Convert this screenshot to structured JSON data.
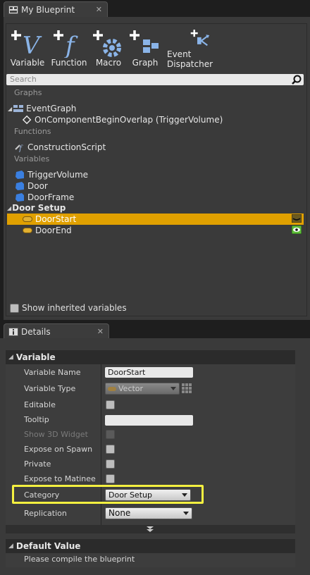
{
  "blueprint_tab": {
    "title": "My Blueprint",
    "close": "✕"
  },
  "toolbar": [
    {
      "label": "Variable",
      "icon": "add-variable-icon"
    },
    {
      "label": "Function",
      "icon": "add-function-icon"
    },
    {
      "label": "Macro",
      "icon": "add-macro-icon"
    },
    {
      "label": "Graph",
      "icon": "add-graph-icon"
    },
    {
      "label": "Event Dispatcher",
      "icon": "add-event-dispatcher-icon"
    }
  ],
  "search": {
    "placeholder": "Search"
  },
  "sections": {
    "graphs": "Graphs",
    "functions": "Functions",
    "variables": "Variables"
  },
  "graphs": {
    "event_graph": "EventGraph",
    "event": "OnComponentBeginOverlap (TriggerVolume)"
  },
  "functions": {
    "construction_script": "ConstructionScript"
  },
  "variables": [
    "TriggerVolume",
    "Door",
    "DoorFrame"
  ],
  "door_setup": {
    "category": "Door Setup",
    "items": [
      {
        "label": "DoorStart",
        "selected": true
      },
      {
        "label": "DoorEnd",
        "selected": false
      }
    ]
  },
  "show_inherited": "Show inherited variables",
  "details_tab": {
    "title": "Details",
    "close": "✕"
  },
  "details": {
    "section_variable": "Variable",
    "labels": {
      "name": "Variable Name",
      "type": "Variable Type",
      "editable": "Editable",
      "tooltip": "Tooltip",
      "show3d": "Show 3D Widget",
      "expose_spawn": "Expose on Spawn",
      "private": "Private",
      "expose_matinee": "Expose to Matinee",
      "category": "Category",
      "replication": "Replication"
    },
    "values": {
      "name": "DoorStart",
      "type": "Vector",
      "tooltip": "",
      "category": "Door Setup",
      "replication": "None"
    },
    "section_default": "Default Value",
    "default_message": "Please compile the blueprint"
  },
  "colors": {
    "selected_row": "#e0a000",
    "highlight": "#f4f040",
    "vector_pill": "#e2b030",
    "visible_icon_bg": "#5fbf3a"
  }
}
